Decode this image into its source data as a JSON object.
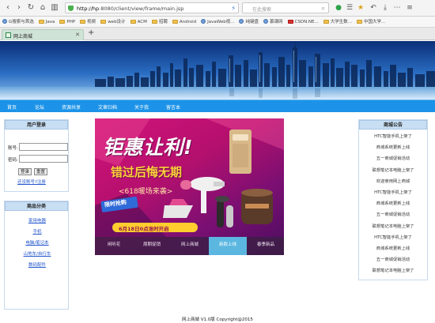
{
  "browser": {
    "url_host": "http://hp",
    "url_rest": ":8080/client/view/frame/main.jsp",
    "search_placeholder": "在此搜索"
  },
  "bookmarks": [
    {
      "label": "G搜索与首选",
      "kind": "g"
    },
    {
      "label": "Java",
      "kind": "f"
    },
    {
      "label": "PHP",
      "kind": "f"
    },
    {
      "label": "视频",
      "kind": "f"
    },
    {
      "label": "web设计",
      "kind": "f"
    },
    {
      "label": "ACM",
      "kind": "f"
    },
    {
      "label": "招聘",
      "kind": "f"
    },
    {
      "label": "Android",
      "kind": "f"
    },
    {
      "label": "JavaWeb视...",
      "kind": "g"
    },
    {
      "label": "纯键盘",
      "kind": "g"
    },
    {
      "label": "慕课网",
      "kind": "g"
    },
    {
      "label": "CSDN.NE...",
      "kind": "r"
    },
    {
      "label": "大学生数...",
      "kind": "f"
    },
    {
      "label": "中国大学...",
      "kind": "f"
    }
  ],
  "tab": {
    "title": "网上商城",
    "new_tab": "+"
  },
  "nav": [
    "首页",
    "论坛",
    "资源共享",
    "文章归档",
    "关于我",
    "留言本"
  ],
  "login": {
    "title": "用户登录",
    "account_label": "账号:",
    "password_label": "密码:",
    "login_button": "登录",
    "reset_button": "重置",
    "register_link": "还没账号?注册"
  },
  "categories": {
    "title": "商品分类",
    "items": [
      "家用电器",
      "手机",
      "电脑/笔记本",
      "山地车/自行车",
      "数码配件"
    ]
  },
  "promo": {
    "headline": "钜惠让利!",
    "subhead": "错过后悔无期",
    "event": "<618暖场来袭>",
    "badge": "限时抢购",
    "time_note": "6月18日0点准时开启",
    "tabs": [
      "闲听花",
      "周期促销",
      "网上商城",
      "新款上线",
      "春季新品"
    ],
    "active_tab": 3
  },
  "notices": {
    "title": "商城公告",
    "items": [
      "HTC智能手机上架了",
      "商城系统更新上线",
      "五一商城促销活动",
      "联想笔记本电脑上架了",
      "欢迎使用网上商城",
      "HTC智能手机上架了",
      "商城系统更新上线",
      "五一商城促销活动",
      "联想笔记本电脑上架了",
      "HTC智能手机上架了",
      "商城系统更新上线",
      "五一商城促销活动",
      "联想笔记本电脑上架了"
    ]
  },
  "footer": "网上商城  V1.0版  Copyright@2015"
}
